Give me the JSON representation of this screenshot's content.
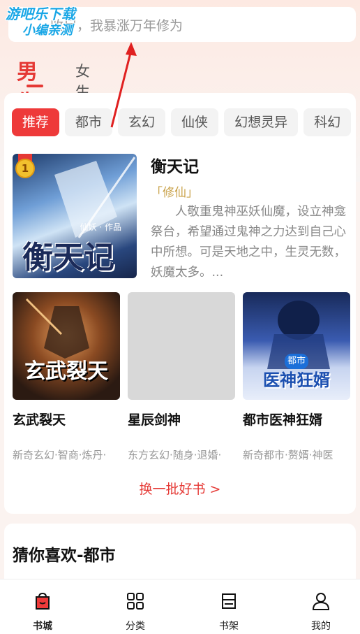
{
  "watermark": {
    "line1": "游吧乐下载",
    "line2": "小编亲测"
  },
  "search": {
    "placeholder": "从收尸人到收尸，我暴涨万年修为",
    "visible_text": "收尸，我暴涨万年修为"
  },
  "gender_tabs": {
    "male": "男生",
    "female": "女生",
    "active": "男生"
  },
  "categories": [
    "推荐",
    "都市",
    "玄幻",
    "仙侠",
    "幻想灵异",
    "科幻"
  ],
  "active_category": "推荐",
  "featured": {
    "rank": "1",
    "title": "衡天记",
    "tag": "「修仙」",
    "description": "人敬重鬼神巫妖仙魔，设立神龛祭台，希望通过鬼神之力达到自己心中所想。可是天地之中，生灵无数，妖魔太多。...",
    "cover_author": "仙妖 · 作品",
    "cover_title": "衡天记"
  },
  "books": [
    {
      "name": "玄武裂天",
      "tags": "新奇玄幻·智商·炼丹·",
      "cover_text": "玄武裂天"
    },
    {
      "name": "星辰剑神",
      "tags": "东方玄幻·随身·退婚·",
      "cover_text": ""
    },
    {
      "name": "都市医神狂婿",
      "tags": "新奇都市·赘婿·神医",
      "cover_badge": "都市",
      "cover_text": "医神狂婿"
    }
  ],
  "refresh_label": "换一批好书 >",
  "guess": {
    "title": "猜你喜欢-都市"
  },
  "tabbar": [
    {
      "label": "书城",
      "icon": "bookstore-icon",
      "active": true
    },
    {
      "label": "分类",
      "icon": "category-grid-icon",
      "active": false
    },
    {
      "label": "书架",
      "icon": "bookshelf-icon",
      "active": false
    },
    {
      "label": "我的",
      "icon": "profile-icon",
      "active": false
    }
  ],
  "colors": {
    "accent": "#e53935",
    "tag_gold": "#c9a24a",
    "annotation_arrow": "#e02020"
  }
}
